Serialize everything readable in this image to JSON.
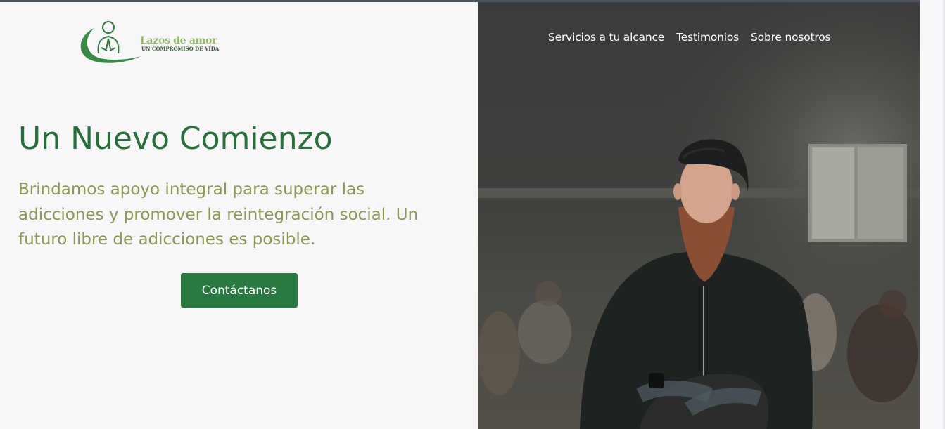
{
  "brand": {
    "name": "Lazos de amor",
    "tagline": "UN COMPROMISO DE VIDA",
    "logo_icon": "praying-person-icon",
    "colors": {
      "name": "#8fbc6a",
      "tagline": "#2f5b2b",
      "swoosh": "#3a8a45"
    }
  },
  "nav": {
    "items": [
      {
        "label": "Servicios a tu alcance"
      },
      {
        "label": "Testimonios"
      },
      {
        "label": "Sobre nosotros"
      }
    ]
  },
  "hero": {
    "title": "Un Nuevo Comienzo",
    "subtitle": "Brindamos apoyo integral para superar las adicciones y promover la reintegración social. Un futuro libre de adicciones es posible.",
    "cta_label": "Contáctanos",
    "image": "man-in-cap-with-beard-arms-crossed-group-therapy-photo"
  },
  "colors": {
    "background": "#f8f6f8",
    "title": "#27703b",
    "subtitle": "#8a9a55",
    "button": "#287a42",
    "nav_text": "#ffffff"
  }
}
